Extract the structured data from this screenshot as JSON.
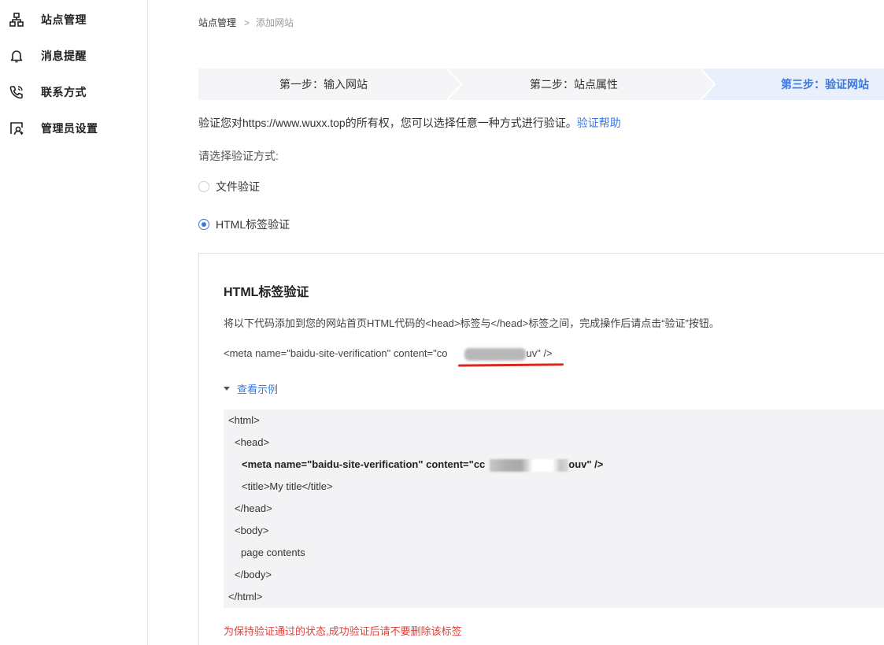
{
  "sidebar": {
    "items": [
      {
        "label": "站点管理",
        "icon": "sitemap-icon"
      },
      {
        "label": "消息提醒",
        "icon": "bell-icon"
      },
      {
        "label": "联系方式",
        "icon": "phone-icon"
      },
      {
        "label": "管理员设置",
        "icon": "admin-icon"
      }
    ]
  },
  "breadcrumb": {
    "root": "站点管理",
    "separator": ">",
    "current": "添加网站"
  },
  "steps": [
    {
      "label": "第一步：输入网站",
      "active": false
    },
    {
      "label": "第二步：站点属性",
      "active": false
    },
    {
      "label": "第三步：验证网站",
      "active": true
    }
  ],
  "verify": {
    "description": "验证您对https://www.wuxx.top的所有权，您可以选择任意一种方式进行验证。",
    "help_link": "验证帮助",
    "choose_label": "请选择验证方式:",
    "options": [
      {
        "label": "文件验证",
        "checked": false
      },
      {
        "label": "HTML标签验证",
        "checked": true
      }
    ]
  },
  "panel": {
    "title": "HTML标签验证",
    "instruction": "将以下代码添加到您的网站首页HTML代码的<head>标签与</head>标签之间，完成操作后请点击“验证”按钮。",
    "meta_prefix": "<meta name=\"baidu-site-verification\" content=\"co",
    "meta_suffix": "uv\" />",
    "example_toggle": "查看示例",
    "code_lines": {
      "html_open": "<html>",
      "head_open": "<head>",
      "meta_prefix": "<meta name=\"baidu-site-verification\" content=\"cc",
      "meta_suffix": "ouv\" />",
      "title": "<title>My title</title>",
      "head_close": "</head>",
      "body_open": "<body>",
      "page_contents": "page contents",
      "body_close": "</body>",
      "html_close": "</html>"
    },
    "note": "为保持验证通过的状态,成功验证后请不要删除该标签"
  },
  "colors": {
    "accent": "#3a78e0",
    "warning": "#e0403a",
    "underline": "#d9281e"
  }
}
